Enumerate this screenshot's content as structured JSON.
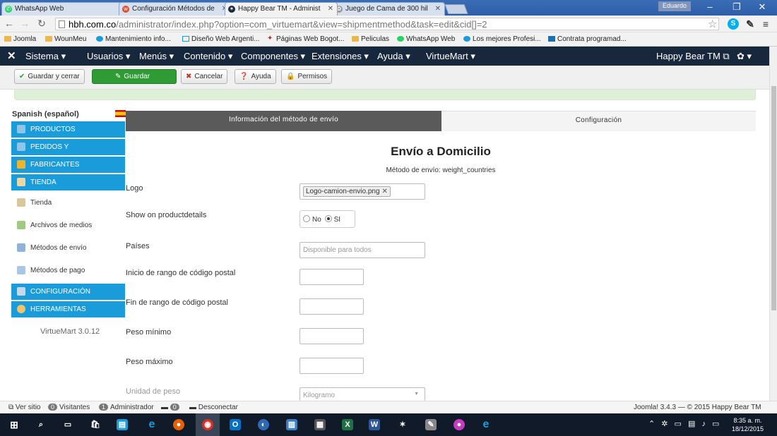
{
  "browser": {
    "tabs": [
      {
        "label": "WhatsApp Web",
        "active": false
      },
      {
        "label": "Configuración Métodos de",
        "active": false
      },
      {
        "label": "Happy Bear TM - Administ",
        "active": true
      },
      {
        "label": "Juego de Cama de 300 hil",
        "active": false
      }
    ],
    "user_badge": "Eduardo",
    "url_host": "hbh.com.co",
    "url_path": "/administrator/index.php?option=com_virtuemart&view=shipmentmethod&task=edit&cid[]=2",
    "bookmarks": [
      "Joomla",
      "WounMeu",
      "Mantenimiento info...",
      "Diseño Web Argenti...",
      "Páginas Web Bogot...",
      "Peliculas",
      "WhatsApp Web",
      "Los mejores Profesi...",
      "Contrata programad..."
    ]
  },
  "adminnav": {
    "items": [
      "Sistema ▾",
      "Usuarios ▾",
      "Menús ▾",
      "Contenido ▾",
      "Componentes ▾",
      "Extensiones ▾",
      "Ayuda ▾",
      "VirtueMart ▾"
    ],
    "site_name": "Happy Bear TM ⧉",
    "settings": "✿ ▾"
  },
  "toolbar": {
    "save_close": "Guardar y cerrar",
    "save": "Guardar",
    "cancel": "Cancelar",
    "help": "Ayuda",
    "permissions": "Permisos"
  },
  "sidebar": {
    "language": "Spanish (español)",
    "items": [
      {
        "label": "PRODUCTOS",
        "type": "cat"
      },
      {
        "label": "PEDIDOS Y",
        "type": "cat"
      },
      {
        "label": "FABRICANTES",
        "type": "cat"
      },
      {
        "label": "TIENDA",
        "type": "cat"
      },
      {
        "label": "Tienda",
        "type": "sub"
      },
      {
        "label": "Archivos de medios",
        "type": "sub"
      },
      {
        "label": "Métodos de envío",
        "type": "sub"
      },
      {
        "label": "Métodos de pago",
        "type": "sub"
      },
      {
        "label": "CONFIGURACIÓN",
        "type": "cat"
      },
      {
        "label": "HERRAMIENTAS",
        "type": "cat"
      }
    ],
    "version": "VirtueMart 3.0.12"
  },
  "tabs": {
    "info": "Información del método de envío",
    "config": "Configuración"
  },
  "main": {
    "title": "Envío a Domicilio",
    "subtitle": "Método de envío: weight_countries"
  },
  "form": {
    "logo_label": "Logo",
    "logo_value": "Logo-camion-envio.png",
    "show_label": "Show on productdetails",
    "radio_no": "No",
    "radio_si": "SI",
    "countries_label": "Países",
    "countries_placeholder": "Disponible para todos",
    "zip_start_label": "Inicio de rango de código postal",
    "zip_end_label": "Fin de rango de código postal",
    "weight_min_label": "Peso mínimo",
    "weight_max_label": "Peso máximo",
    "weight_unit_label": "Unidad de peso",
    "weight_unit_value": "Kilogramo"
  },
  "statusbar": {
    "view_site": "Ver sitio",
    "visitors_count": "0",
    "visitors_label": "Visitantes",
    "admins_count": "1",
    "admins_label": "Administrador",
    "messages_count": "0",
    "logout": "Desconectar",
    "footer": "Joomla! 3.4.3 — © 2015 Happy Bear TM"
  },
  "taskbar": {
    "time": "8:35 a. m.",
    "date": "18/12/2015"
  },
  "colors": {
    "nav_bg": "#17273c",
    "accent_blue": "#1a9cdb",
    "save_green": "#2f9b34",
    "success_bg": "#dff0d8"
  }
}
